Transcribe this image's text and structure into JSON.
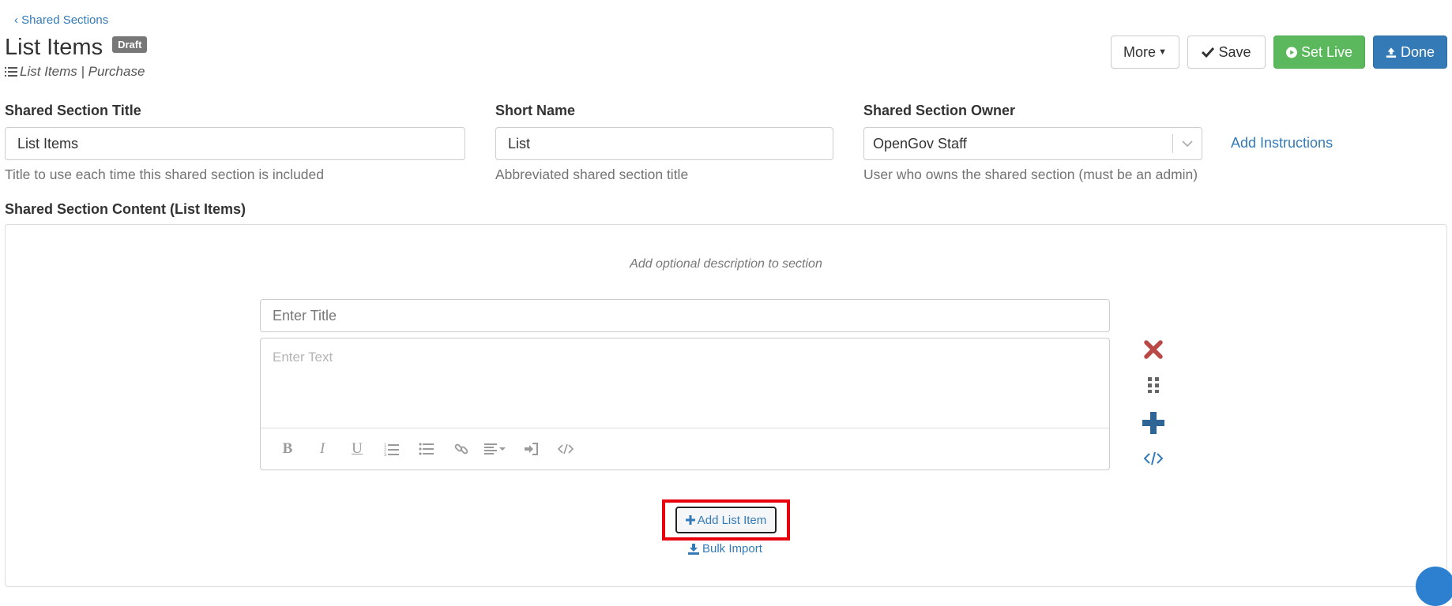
{
  "nav": {
    "back_label": "Shared Sections"
  },
  "header": {
    "title": "List Items",
    "badge": "Draft",
    "subtitle": "List Items | Purchase",
    "subtitle_icon": "list-numbered-icon"
  },
  "toolbar": {
    "more_label": "More",
    "save_label": "Save",
    "set_live_label": "Set Live",
    "done_label": "Done"
  },
  "form": {
    "title": {
      "label": "Shared Section Title",
      "value": "List Items",
      "help": "Title to use each time this shared section is included"
    },
    "short_name": {
      "label": "Short Name",
      "value": "List",
      "help": "Abbreviated shared section title"
    },
    "owner": {
      "label": "Shared Section Owner",
      "value": "OpenGov Staff",
      "help": "User who owns the shared section (must be an admin)"
    },
    "add_instructions_label": "Add Instructions"
  },
  "content": {
    "label": "Shared Section Content (List Items)",
    "description_placeholder": "Add optional description to section",
    "item": {
      "title_placeholder": "Enter Title",
      "text_placeholder": "Enter Text",
      "toolbar": [
        "bold",
        "italic",
        "underline",
        "ordered-list",
        "unordered-list",
        "link",
        "align",
        "insert",
        "code"
      ]
    },
    "add_item_label": "Add List Item",
    "bulk_import_label": "Bulk Import"
  },
  "colors": {
    "link": "#337ab7",
    "success": "#5cb85c",
    "primary": "#337ab7",
    "danger": "#a94442",
    "highlight": "#e8000d",
    "badge": "#777777"
  }
}
